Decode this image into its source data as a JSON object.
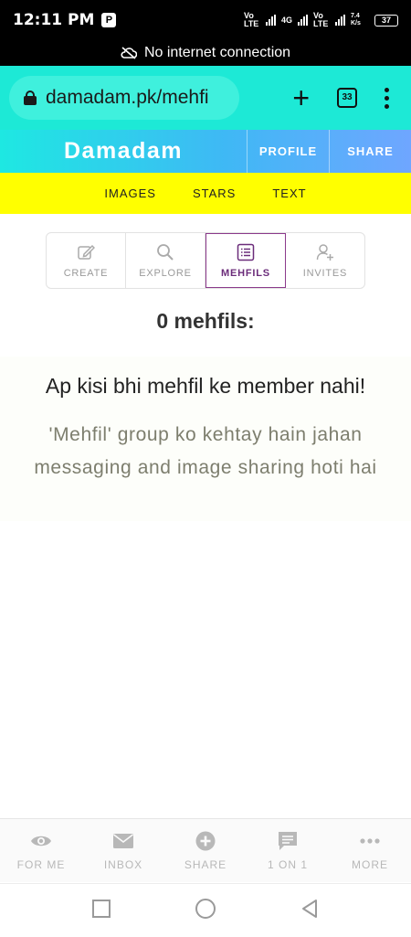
{
  "status_bar": {
    "time": "12:11 PM",
    "app_badge": "P",
    "network_1": "Vo LTE",
    "network_2": "4G",
    "network_3": "Vo LTE",
    "speed": "7.4 K/s",
    "battery": "37"
  },
  "offline_banner": {
    "text": "No internet connection",
    "icon": "cloud-off-icon"
  },
  "browser": {
    "url": "damadam.pk/mehfi",
    "tab_count": "33"
  },
  "site_header": {
    "brand": "Damadam",
    "profile_label": "PROFILE",
    "share_label": "SHARE"
  },
  "top_nav": {
    "items": [
      "IMAGES",
      "STARS",
      "TEXT"
    ]
  },
  "tabs": {
    "active": "MEHFILS",
    "items": [
      {
        "label": "CREATE",
        "icon": "edit-icon"
      },
      {
        "label": "EXPLORE",
        "icon": "search-icon"
      },
      {
        "label": "MEHFILS",
        "icon": "list-icon"
      },
      {
        "label": "INVITES",
        "icon": "add-user-icon"
      }
    ]
  },
  "main": {
    "count_title": "0 mehfils:",
    "empty_heading": "Ap kisi bhi mehfil ke member nahi!",
    "empty_description": "'Mehfil' group ko kehtay hain jahan messaging and image sharing hoti hai"
  },
  "bottom_nav": {
    "items": [
      {
        "label": "FOR ME",
        "icon": "eye-icon"
      },
      {
        "label": "INBOX",
        "icon": "mail-icon"
      },
      {
        "label": "SHARE",
        "icon": "plus-circle-icon"
      },
      {
        "label": "1 ON 1",
        "icon": "chat-icon"
      },
      {
        "label": "MORE",
        "icon": "more-dots-icon"
      }
    ]
  },
  "colors": {
    "browser_bar": "#1de9d6",
    "nav_yellow": "#ffff00",
    "active_tab": "#6b2c7a"
  }
}
